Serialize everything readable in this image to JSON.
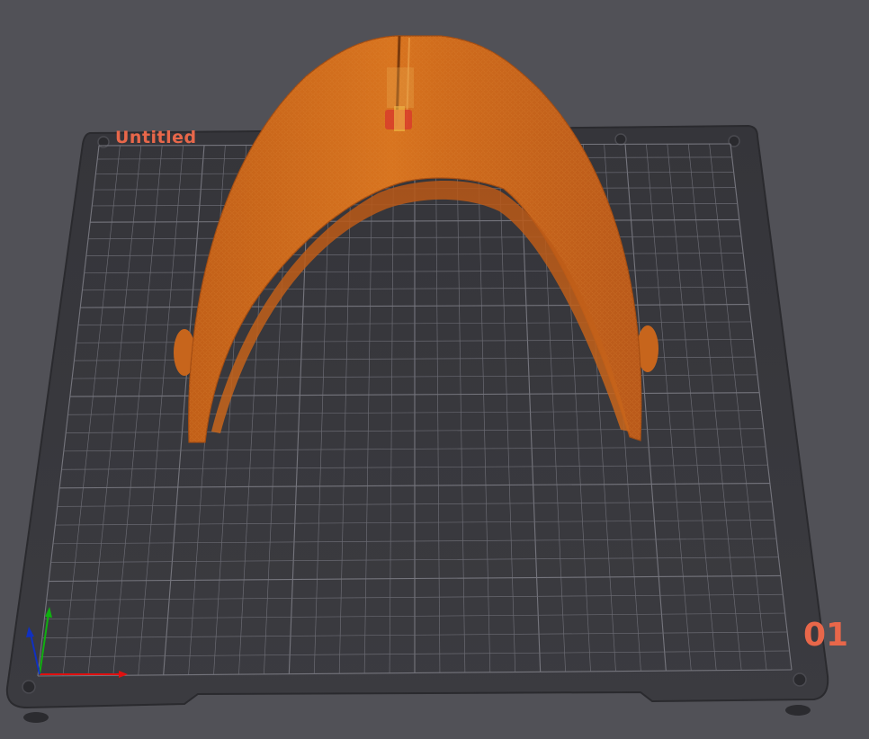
{
  "plate": {
    "name": "Untitled",
    "number": "01"
  },
  "colors": {
    "background": "#515157",
    "bed": "#38383d",
    "grid_line": "#6a6a72",
    "model": "#d2691e",
    "plate_label": "#e8674a",
    "axis_x": "#e01010",
    "axis_y": "#10b010",
    "axis_z": "#1030c0"
  },
  "model": {
    "type": "arch-shaped print object"
  },
  "axes_icon": {
    "x": "x-axis",
    "y": "y-axis",
    "z": "z-axis"
  }
}
